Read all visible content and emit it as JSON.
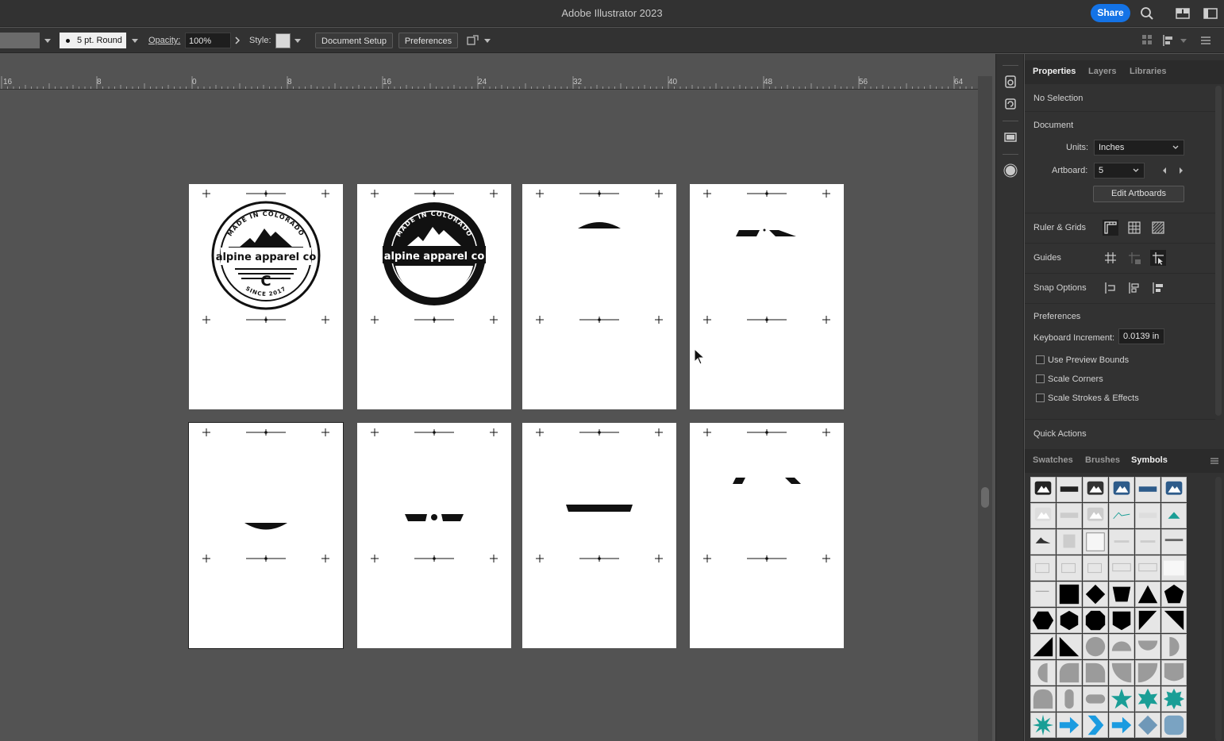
{
  "app": {
    "title": "Adobe Illustrator 2023",
    "share_label": "Share"
  },
  "control_bar": {
    "stroke_profile": "5 pt. Round",
    "opacity_label": "Opacity:",
    "opacity_value": "100%",
    "style_label": "Style:",
    "document_setup_label": "Document Setup",
    "preferences_label": "Preferences"
  },
  "ruler": {
    "labels": [
      "16",
      "8",
      "0",
      "8",
      "16",
      "24",
      "32",
      "40",
      "48",
      "56",
      "64"
    ]
  },
  "artboards": [
    {
      "id": 1,
      "content": "badge-outline",
      "badge_top": "MADE IN COLORADO",
      "badge_main": "alpine apparel co",
      "badge_bottom": "SINCE 2017",
      "badge_letter": "C"
    },
    {
      "id": 2,
      "content": "badge-solid",
      "badge_top": "MADE IN COLORADO",
      "badge_main": "alpine apparel co",
      "badge_bottom": "SINCE 2017"
    },
    {
      "id": 3,
      "content": "arc-top"
    },
    {
      "id": 4,
      "content": "tabs-top"
    },
    {
      "id": 5,
      "content": "arc-bottom",
      "active": true
    },
    {
      "id": 6,
      "content": "bar-dot"
    },
    {
      "id": 7,
      "content": "bar-wide"
    },
    {
      "id": 8,
      "content": "tabs-small"
    }
  ],
  "panel": {
    "tabs": [
      "Properties",
      "Layers",
      "Libraries"
    ],
    "active_tab": "Properties",
    "selection_status": "No Selection",
    "document_heading": "Document",
    "units_label": "Units:",
    "units_value": "Inches",
    "artboard_label": "Artboard:",
    "artboard_value": "5",
    "edit_artboards_label": "Edit Artboards",
    "ruler_grids_label": "Ruler & Grids",
    "guides_label": "Guides",
    "snap_options_label": "Snap Options",
    "preferences_heading": "Preferences",
    "keyboard_increment_label": "Keyboard Increment:",
    "keyboard_increment_value": "0.0139 in",
    "use_preview_bounds_label": "Use Preview Bounds",
    "scale_corners_label": "Scale Corners",
    "scale_strokes_label": "Scale Strokes & Effects",
    "quick_actions_label": "Quick Actions"
  },
  "symbols_panel": {
    "tabs": [
      "Swatches",
      "Brushes",
      "Symbols"
    ],
    "active_tab": "Symbols",
    "accent_teal": "#1a9e96",
    "accent_blue": "#1b9be0",
    "shape_gray": "#9b9b9b"
  }
}
